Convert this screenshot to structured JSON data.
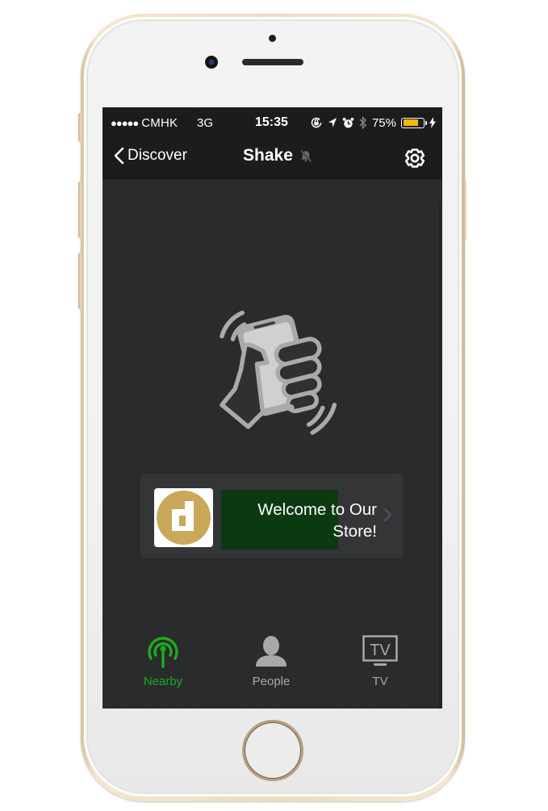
{
  "status_bar": {
    "signal_dots": "●●●●●",
    "carrier": "CMHK",
    "network": "3G",
    "time": "15:35",
    "icons": [
      "rotation-lock-icon",
      "location-arrow-icon",
      "alarm-clock-icon",
      "bluetooth-icon"
    ],
    "battery_percent_label": "75%",
    "battery_level": 0.75,
    "charging": true
  },
  "nav_bar": {
    "back_label": "Discover",
    "title": "Shake",
    "title_icon": "mute-bell-icon",
    "right_icon": "gear-icon"
  },
  "main": {
    "illustration": "hand-shaking-phone-icon",
    "banner": {
      "logo": "d-logo",
      "message": "Welcome to Our Store!",
      "chevron": "chevron-right-icon"
    }
  },
  "tabs": [
    {
      "label": "Nearby",
      "icon": "beacon-icon",
      "active": true
    },
    {
      "label": "People",
      "icon": "person-icon",
      "active": false
    },
    {
      "label": "TV",
      "icon": "tv-icon",
      "active": false
    }
  ],
  "colors": {
    "accent_green": "#1aad19",
    "inactive_gray": "#a8a8a8",
    "screen_bg": "#2a2b2d",
    "nav_bg": "#1c1c1e",
    "battery_fill": "#f5b800",
    "logo_gold": "#c9a85c",
    "banner_message_bg": "#0b3a12"
  }
}
